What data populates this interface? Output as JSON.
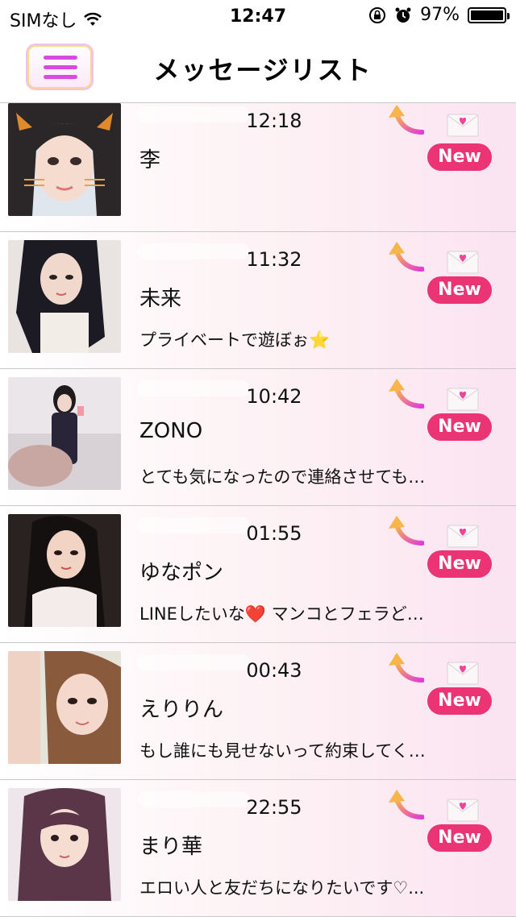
{
  "status_bar": {
    "carrier": "SIMなし",
    "time": "12:47",
    "battery_percent": "97%",
    "battery_level": 0.97
  },
  "nav": {
    "title": "メッセージリスト"
  },
  "colors": {
    "badge": "#ea3474",
    "menu_bars": "#d94be0"
  },
  "messages": [
    {
      "time": "12:18",
      "name": "李",
      "badge": "New",
      "preview": ""
    },
    {
      "time": "11:32",
      "name": "未来",
      "badge": "New",
      "preview": "プライベートで遊ぼぉ⭐"
    },
    {
      "time": "10:42",
      "name": "ZONO",
      "badge": "New",
      "preview": "とても気になったので連絡させても…"
    },
    {
      "time": "01:55",
      "name": "ゆなポン",
      "badge": "New",
      "preview": "LINEしたいな❤️ マンコとフェラど…"
    },
    {
      "time": "00:43",
      "name": "えりりん",
      "badge": "New",
      "preview": "もし誰にも見せないって約束してく…"
    },
    {
      "time": "22:55",
      "name": "まり華",
      "badge": "New",
      "preview": "エロい人と友だちになりたいです♡..."
    }
  ]
}
